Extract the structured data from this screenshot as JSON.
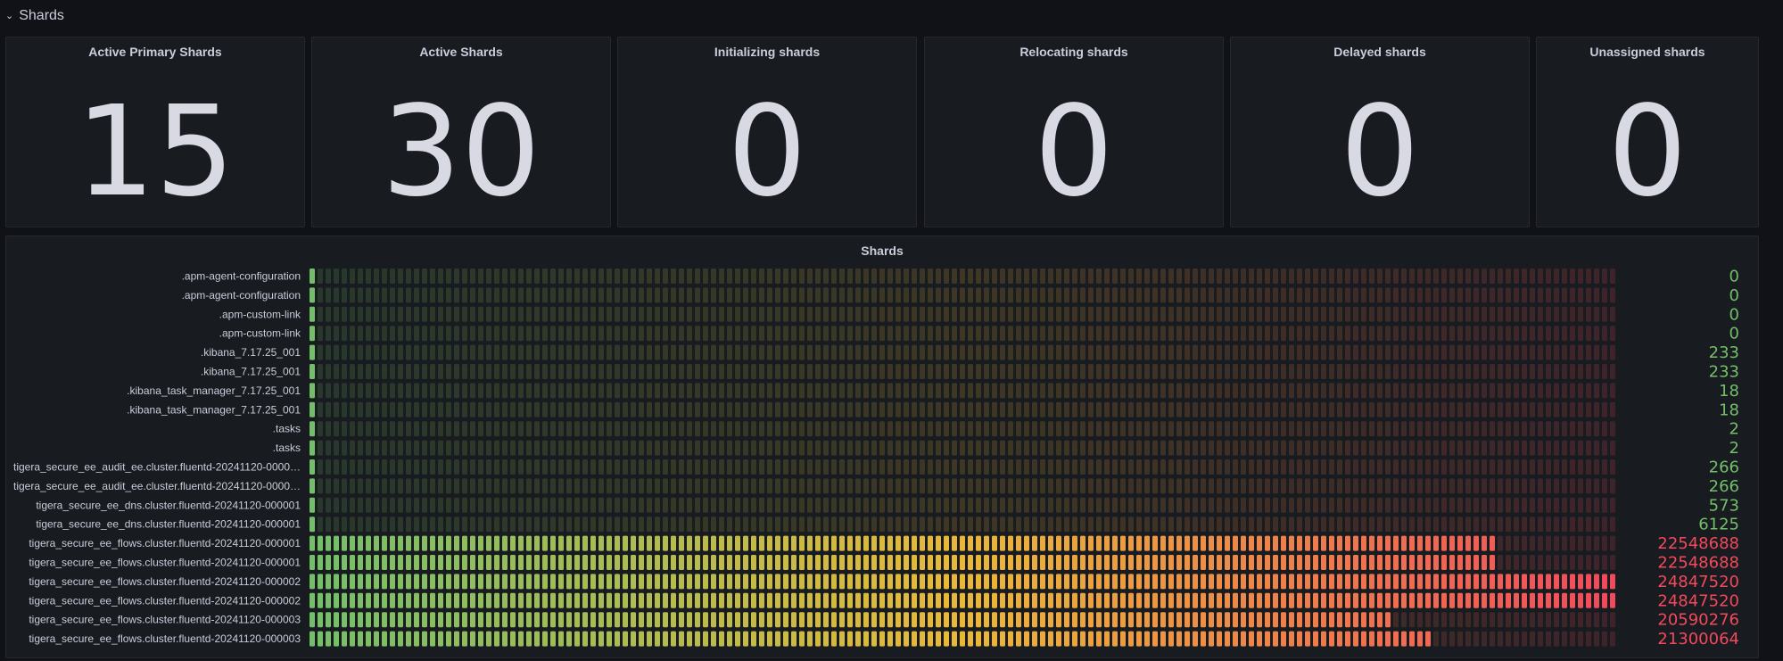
{
  "row": {
    "title": "Shards",
    "icon": "chevron-down-icon"
  },
  "stats": [
    {
      "title": "Active Primary Shards",
      "value": "15"
    },
    {
      "title": "Active Shards",
      "value": "30"
    },
    {
      "title": "Initializing shards",
      "value": "0"
    },
    {
      "title": "Relocating shards",
      "value": "0"
    },
    {
      "title": "Delayed shards",
      "value": "0"
    },
    {
      "title": "Unassigned shards",
      "value": "0"
    }
  ],
  "bargauge": {
    "title": "Shards",
    "min": 0,
    "max": 24847520,
    "colors": {
      "low": "#73bf69",
      "mid": "#eab839",
      "high": "#f2495c",
      "value_low": "#73bf69",
      "value_high": "#f2495c"
    },
    "rows": [
      {
        "label": ".apm-agent-configuration",
        "value": "0",
        "v": 0
      },
      {
        "label": ".apm-agent-configuration",
        "value": "0",
        "v": 0
      },
      {
        "label": ".apm-custom-link",
        "value": "0",
        "v": 0
      },
      {
        "label": ".apm-custom-link",
        "value": "0",
        "v": 0
      },
      {
        "label": ".kibana_7.17.25_001",
        "value": "233",
        "v": 233
      },
      {
        "label": ".kibana_7.17.25_001",
        "value": "233",
        "v": 233
      },
      {
        "label": ".kibana_task_manager_7.17.25_001",
        "value": "18",
        "v": 18
      },
      {
        "label": ".kibana_task_manager_7.17.25_001",
        "value": "18",
        "v": 18
      },
      {
        "label": ".tasks",
        "value": "2",
        "v": 2
      },
      {
        "label": ".tasks",
        "value": "2",
        "v": 2
      },
      {
        "label": "tigera_secure_ee_audit_ee.cluster.fluentd-20241120-0000…",
        "value": "266",
        "v": 266
      },
      {
        "label": "tigera_secure_ee_audit_ee.cluster.fluentd-20241120-0000…",
        "value": "266",
        "v": 266
      },
      {
        "label": "tigera_secure_ee_dns.cluster.fluentd-20241120-000001",
        "value": "573",
        "v": 573
      },
      {
        "label": "tigera_secure_ee_dns.cluster.fluentd-20241120-000001",
        "value": "6125",
        "v": 6125
      },
      {
        "label": "tigera_secure_ee_flows.cluster.fluentd-20241120-000001",
        "value": "22548688",
        "v": 22548688
      },
      {
        "label": "tigera_secure_ee_flows.cluster.fluentd-20241120-000001",
        "value": "22548688",
        "v": 22548688
      },
      {
        "label": "tigera_secure_ee_flows.cluster.fluentd-20241120-000002",
        "value": "24847520",
        "v": 24847520
      },
      {
        "label": "tigera_secure_ee_flows.cluster.fluentd-20241120-000002",
        "value": "24847520",
        "v": 24847520
      },
      {
        "label": "tigera_secure_ee_flows.cluster.fluentd-20241120-000003",
        "value": "20590276",
        "v": 20590276
      },
      {
        "label": "tigera_secure_ee_flows.cluster.fluentd-20241120-000003",
        "value": "21300064",
        "v": 21300064
      }
    ]
  }
}
